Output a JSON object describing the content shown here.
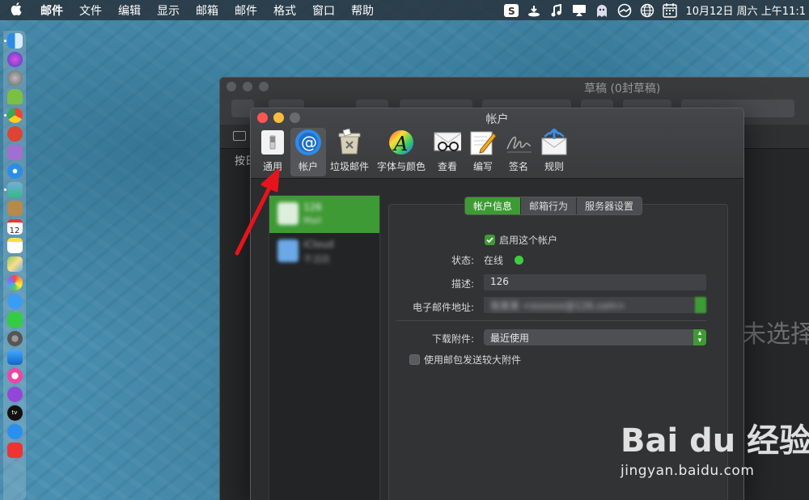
{
  "menubar": {
    "items": [
      "邮件",
      "文件",
      "编辑",
      "显示",
      "邮箱",
      "邮件",
      "格式",
      "窗口",
      "帮助"
    ],
    "clock": "10月12日 周六 上午11:1",
    "status_icons": [
      "sogou-icon",
      "download-icon",
      "music-icon",
      "airplay-icon",
      "ghost-icon",
      "network-icon",
      "globe-icon",
      "calendar-icon"
    ]
  },
  "dock": {
    "apps": [
      "finder",
      "siri",
      "launchpad",
      "android",
      "chrome",
      "app-red",
      "app-gray",
      "safari",
      "preview",
      "notes-brown",
      "calendar",
      "notes",
      "maps",
      "photos",
      "messages",
      "facetime",
      "system-prefs",
      "keynote",
      "itunes",
      "podcasts",
      "appletv",
      "appstore",
      "vivaldi"
    ],
    "calendar_day": "12"
  },
  "mail_window": {
    "title": "草稿 (0封草稿)",
    "tab": "按日",
    "no_selection": "未选择"
  },
  "prefs": {
    "title": "帐户",
    "tabs": [
      {
        "label": "通用",
        "icon": "switch-icon"
      },
      {
        "label": "帐户",
        "icon": "at-icon"
      },
      {
        "label": "垃圾邮件",
        "icon": "trash-icon"
      },
      {
        "label": "字体与颜色",
        "icon": "font-color-icon"
      },
      {
        "label": "查看",
        "icon": "glasses-icon"
      },
      {
        "label": "编写",
        "icon": "pencil-icon"
      },
      {
        "label": "签名",
        "icon": "signature-icon"
      },
      {
        "label": "规则",
        "icon": "rules-icon"
      }
    ],
    "accounts": [
      {
        "name": "126",
        "sub": "Mail"
      },
      {
        "name": "iCloud",
        "sub": "不活跃"
      }
    ],
    "segments": [
      "帐户信息",
      "邮箱行为",
      "服务器设置"
    ],
    "enable_label": "启用这个帐户",
    "status_label": "状态:",
    "status_value": "在线",
    "desc_label": "描述:",
    "desc_value": "126",
    "email_label": "电子邮件地址:",
    "email_value": "张某某 <xxxxxx@126.com>",
    "download_label": "下载附件:",
    "download_value": "最近使用",
    "maildrop_label": "使用邮包发送较大附件"
  },
  "watermark": {
    "logo": "Bai du 经验",
    "url": "jingyan.baidu.com"
  },
  "colors": {
    "accent_green": "#3e9a34",
    "status_online": "#3ecf3e",
    "arrow_red": "#e8141b"
  }
}
